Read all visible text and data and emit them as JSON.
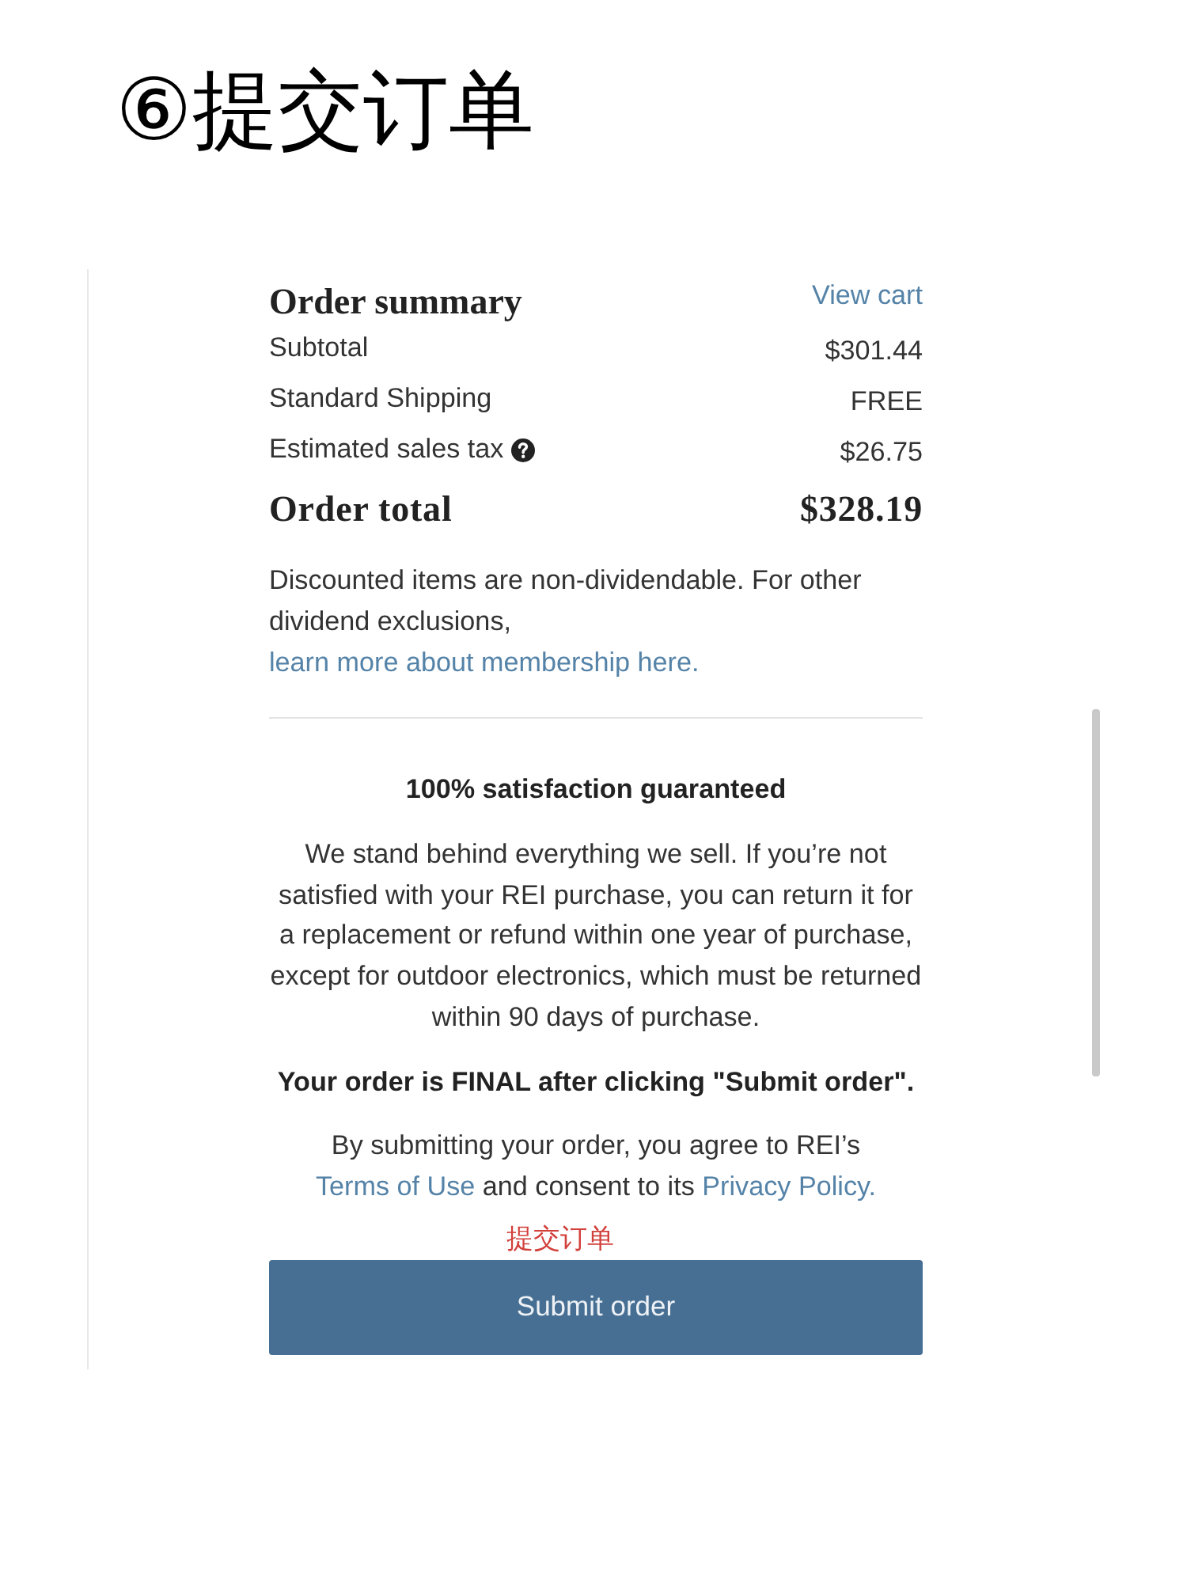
{
  "step_title": "⑥提交订单",
  "order_summary": {
    "title": "Order summary",
    "view_cart_link": "View cart",
    "rows": [
      {
        "label": "Subtotal",
        "value": "$301.44",
        "help_icon": false
      },
      {
        "label": "Standard Shipping",
        "value": "FREE",
        "help_icon": false
      },
      {
        "label": "Estimated sales tax",
        "value": "$26.75",
        "help_icon": true
      }
    ],
    "total": {
      "label": "Order total",
      "value": "$328.19"
    }
  },
  "dividend_note": {
    "text": "Discounted items are non-dividendable. For other dividend exclusions, ",
    "link": "learn more about membership here."
  },
  "guarantee": {
    "title": "100% satisfaction guaranteed",
    "text": "We stand behind everything we sell. If you’re not satisfied with your REI purchase, you can return it for a replacement or refund within one year of purchase, except for outdoor electronics, which must be returned within 90 days of purchase."
  },
  "final_notice": "Your order is FINAL after clicking \"Submit order\".",
  "consent": {
    "before": "By submitting your order, you agree to REI’s ",
    "terms_link": "Terms of Use",
    "middle": " and consent to its ",
    "privacy_link": "Privacy Policy."
  },
  "annotation": "提交订单",
  "submit_button": "Submit order"
}
